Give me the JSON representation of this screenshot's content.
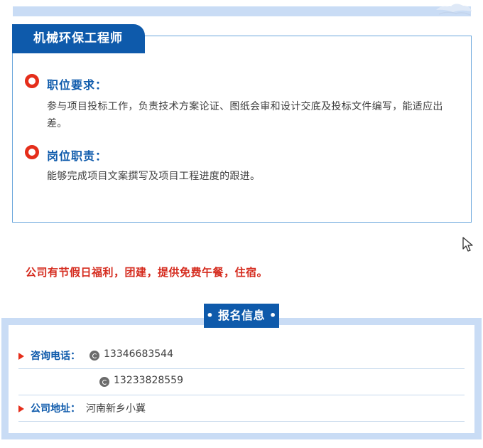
{
  "job": {
    "title": "机械环保工程师",
    "requirements": {
      "heading": "职位要求：",
      "text": "参与项目投标工作，负责技术方案论证、图纸会审和设计交底及投标文件编写，能适应出差。"
    },
    "duties": {
      "heading": "岗位职责：",
      "text": "能够完成项目文案撰写及项目工程进度的跟进。"
    }
  },
  "benefits": "公司有节假日福利，团建，提供免费午餐，住宿。",
  "signup": {
    "title": "• 报名信息 •",
    "phone_label": "咨询电话：",
    "phones": [
      "13346683544",
      "13233828559"
    ],
    "address_label": "公司地址：",
    "address": "河南新乡小冀"
  },
  "colors": {
    "brand_blue": "#0e5aab",
    "accent_red": "#e52e1b",
    "light_blue": "#c9dcf5"
  },
  "icons": {
    "bullet": "ring-bullet-icon",
    "phone": "phone-icon",
    "pointer": "cursor-icon"
  }
}
